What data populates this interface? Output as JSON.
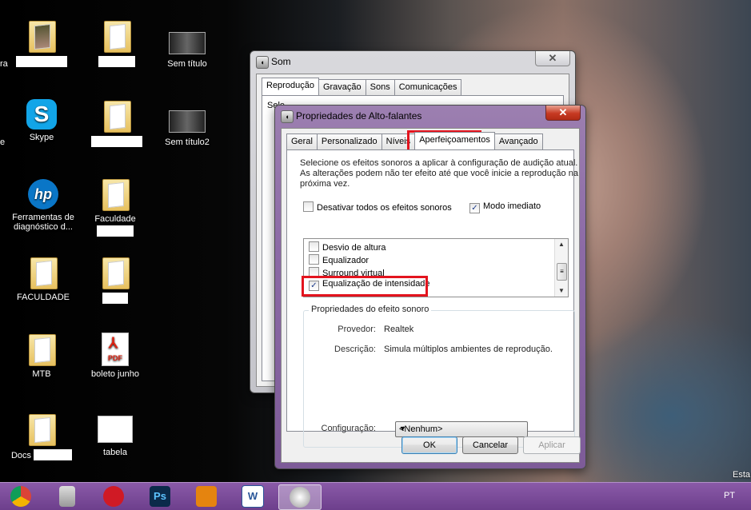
{
  "desktop": {
    "partial_left": [
      "ra",
      "e"
    ],
    "icons": [
      {
        "label": "",
        "kind": "folder-img"
      },
      {
        "label": "",
        "kind": "folder"
      },
      {
        "label": "Sem título",
        "kind": "thumb"
      },
      {
        "label": "Skype",
        "kind": "skype"
      },
      {
        "label": "",
        "kind": "folder"
      },
      {
        "label": "Sem título2",
        "kind": "thumb"
      },
      {
        "label": "Ferramentas de diagnóstico d...",
        "kind": "hp"
      },
      {
        "label": "Faculdade",
        "kind": "folder"
      },
      {
        "label": "FACULDADE",
        "kind": "folder"
      },
      {
        "label": "",
        "kind": "folder"
      },
      {
        "label": "MTB",
        "kind": "folder"
      },
      {
        "label": "boleto junho",
        "kind": "pdf"
      },
      {
        "label": "Docs",
        "kind": "folder"
      },
      {
        "label": "tabela",
        "kind": "sheet"
      }
    ],
    "pdf_badge": "PDF",
    "corner_text": "Esta"
  },
  "som_window": {
    "title": "Som",
    "close": "✕",
    "tabs": [
      "Reprodução",
      "Gravação",
      "Sons",
      "Comunicações"
    ],
    "partial_text": "Sele"
  },
  "prop_window": {
    "title": "Propriedades de Alto-falantes",
    "close": "✕",
    "tabs": [
      "Geral",
      "Personalizado",
      "Níveis",
      "Aperfeiçoamentos",
      "Avançado"
    ],
    "active_tab": "Aperfeiçoamentos",
    "description": "Selecione os efeitos sonoros a aplicar à configuração de audição atual. As alterações podem não ter efeito até que você inicie a reprodução na próxima vez.",
    "disable_all_label": "Desativar todos os efeitos sonoros",
    "disable_all_checked": false,
    "immediate_label": "Modo imediato",
    "immediate_checked": true,
    "effects": [
      {
        "label": "Desvio de altura",
        "checked": false
      },
      {
        "label": "Equalizador",
        "checked": false
      },
      {
        "label": "Surround virtual",
        "checked": false
      },
      {
        "label": "Equalização de intensidade",
        "checked": true
      }
    ],
    "group_title": "Propriedades do efeito sonoro",
    "provider_label": "Provedor:",
    "provider_value": "Realtek",
    "desc_label": "Descrição:",
    "desc_value": "Simula múltiplos ambientes de reprodução.",
    "config_label": "Configuração:",
    "config_value": "<Nenhum>",
    "ok": "OK",
    "cancel": "Cancelar",
    "apply": "Aplicar",
    "highlight_color": "#e3141e"
  },
  "taskbar": {
    "apps": [
      "chrome-icon",
      "calculator-icon",
      "opera-icon",
      "photoshop-icon",
      "media-player-icon",
      "word-icon",
      "speaker-icon"
    ],
    "ps_label": "Ps",
    "word_label": "W",
    "language": "PT"
  }
}
